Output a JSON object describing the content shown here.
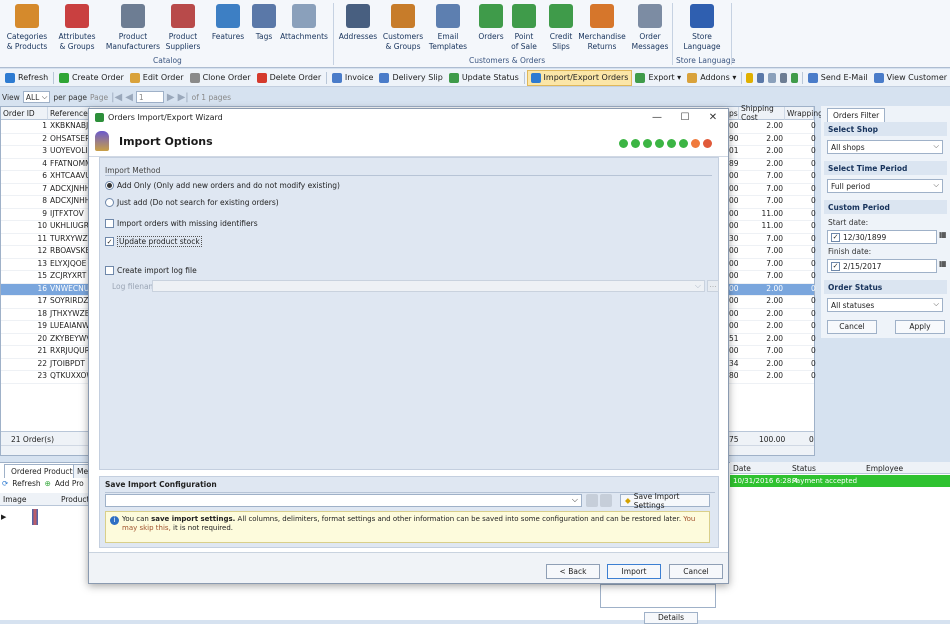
{
  "ribbon": {
    "items": [
      {
        "label": "Categories\n& Products",
        "icon": "categories-products-icon"
      },
      {
        "label": "Attributes\n& Groups",
        "icon": "attributes-icon"
      },
      {
        "label": "Product\nManufacturers",
        "icon": "manufacturer-icon"
      },
      {
        "label": "Product\nSuppliers",
        "icon": "supplier-icon"
      },
      {
        "label": "Features",
        "icon": "features-icon"
      },
      {
        "label": "Tags",
        "icon": "tags-icon"
      },
      {
        "label": "Attachments",
        "icon": "attachments-icon"
      },
      {
        "label": "Addresses",
        "icon": "addresses-icon"
      },
      {
        "label": "Customers\n& Groups",
        "icon": "customers-icon"
      },
      {
        "label": "Email\nTemplates",
        "icon": "email-templates-icon"
      },
      {
        "label": "Orders",
        "icon": "orders-icon"
      },
      {
        "label": "Point\nof Sale",
        "icon": "point-of-sale-icon"
      },
      {
        "label": "Credit\nSlips",
        "icon": "credit-slips-icon"
      },
      {
        "label": "Merchandise\nReturns",
        "icon": "returns-icon"
      },
      {
        "label": "Order\nMessages",
        "icon": "order-messages-icon"
      },
      {
        "label": "Store\nLanguage",
        "icon": "store-language-icon"
      }
    ],
    "groups": [
      "Catalog",
      "Customers & Orders",
      "Store Language"
    ]
  },
  "toolbar": {
    "items": [
      "Refresh",
      "Create Order",
      "Edit Order",
      "Clone Order",
      "Delete Order",
      "Invoice",
      "Delivery Slip",
      "Update Status",
      "Import/Export Orders",
      "Export ▾",
      "Addons ▾",
      "Send E-Mail",
      "View Customer"
    ]
  },
  "pager": {
    "view": "View",
    "all": "ALL",
    "per_page": "per page",
    "page": "Page",
    "page_num": "1",
    "of_pages": "of 1 pages"
  },
  "grid": {
    "headers": [
      "Order ID",
      "Reference",
      "ps",
      "Shipping Cost",
      "Wrapping"
    ],
    "rows": [
      {
        "id": "1",
        "ref": "XKBKNABJK",
        "a": "00",
        "ship": "2.00",
        "w": "0"
      },
      {
        "id": "2",
        "ref": "OHSATSERP",
        "a": "90",
        "ship": "2.00",
        "w": "0"
      },
      {
        "id": "3",
        "ref": "UOYEVOLI",
        "a": "01",
        "ship": "2.00",
        "w": "0"
      },
      {
        "id": "4",
        "ref": "FFATNOMM",
        "a": "89",
        "ship": "2.00",
        "w": "0"
      },
      {
        "id": "6",
        "ref": "XHTCAAVU",
        "a": "00",
        "ship": "7.00",
        "w": "0"
      },
      {
        "id": "7",
        "ref": "ADCXJNHH",
        "a": "00",
        "ship": "7.00",
        "w": "0"
      },
      {
        "id": "8",
        "ref": "ADCXJNHH",
        "a": "00",
        "ship": "7.00",
        "w": "0"
      },
      {
        "id": "9",
        "ref": "IJTFXTOV",
        "a": "00",
        "ship": "11.00",
        "w": "0"
      },
      {
        "id": "10",
        "ref": "UKHLIUGR",
        "a": "00",
        "ship": "11.00",
        "w": "0"
      },
      {
        "id": "11",
        "ref": "TURXYWZV",
        "a": "30",
        "ship": "7.00",
        "w": "0"
      },
      {
        "id": "12",
        "ref": "RBOAVSKB",
        "a": "00",
        "ship": "7.00",
        "w": "0"
      },
      {
        "id": "13",
        "ref": "ELYXJQOE",
        "a": "00",
        "ship": "7.00",
        "w": "0"
      },
      {
        "id": "15",
        "ref": "ZCJRYXRT",
        "a": "00",
        "ship": "7.00",
        "w": "0"
      },
      {
        "id": "16",
        "ref": "VNWECNUM",
        "a": "00",
        "ship": "2.00",
        "w": "0"
      },
      {
        "id": "17",
        "ref": "SOYRIRDZ",
        "a": "00",
        "ship": "2.00",
        "w": "0"
      },
      {
        "id": "18",
        "ref": "JTHXYWZB",
        "a": "00",
        "ship": "2.00",
        "w": "0"
      },
      {
        "id": "19",
        "ref": "LUEAIANW",
        "a": "00",
        "ship": "2.00",
        "w": "0"
      },
      {
        "id": "20",
        "ref": "ZKYBEYWV",
        "a": "51",
        "ship": "2.00",
        "w": "0"
      },
      {
        "id": "21",
        "ref": "RXRJUQUR",
        "a": "00",
        "ship": "7.00",
        "w": "0"
      },
      {
        "id": "22",
        "ref": "JTOIBPDT",
        "a": "34",
        "ship": "2.00",
        "w": "0"
      },
      {
        "id": "23",
        "ref": "QTKUXXOW",
        "a": "80",
        "ship": "2.00",
        "w": "0"
      }
    ],
    "selected_index": 13,
    "footer_count": "21 Order(s)",
    "footer_a": "75",
    "footer_ship": "100.00",
    "footer_w": "0"
  },
  "filter": {
    "tab": "Orders Filter",
    "select_shop": "Select Shop",
    "shop_value": "All shops",
    "select_time": "Select Time Period",
    "time_value": "Full period",
    "custom_period": "Custom Period",
    "start_label": "Start date:",
    "start_value": "12/30/1899",
    "finish_label": "Finish date:",
    "finish_value": "2/15/2017",
    "order_status": "Order Status",
    "status_value": "All statuses",
    "cancel": "Cancel",
    "apply": "Apply"
  },
  "bottom": {
    "tabs": [
      "Ordered Products",
      "Mes"
    ],
    "refresh": "Refresh",
    "add": "Add Pro",
    "col_image": "Image",
    "col_product": "Product",
    "hist_headers": [
      "Date",
      "Status",
      "Employee"
    ],
    "hist_date": "10/31/2016 6:28:4",
    "hist_status": "Payment accepted",
    "details_btn": "Details"
  },
  "dialog": {
    "window_title": "Orders Import/Export Wizard",
    "heading": "Import Options",
    "import_method": "Import Method",
    "opt_add_only": "Add Only (Only add new orders and do not modify existing)",
    "opt_just_add": "Just add (Do not search for existing orders)",
    "chk_missing": "Import orders with missing identifiers",
    "chk_stock": "Update product stock",
    "chk_log": "Create import log file",
    "log_label": "Log filename",
    "save_title": "Save Import Configuration",
    "save_btn": "Save Import Settings",
    "info_a": "You can ",
    "info_b": "save import settings.",
    "info_c": " All columns, delimiters, format settings and other information can be saved into some configuration and can be restored later. ",
    "info_d": "You may skip this,",
    "info_e": " it is not required.",
    "back": "< Back",
    "import": "Import",
    "cancel": "Cancel",
    "steps": [
      "#3cb544",
      "#3cb544",
      "#3cb544",
      "#3cb544",
      "#3cb544",
      "#3cb544",
      "#f07a3c",
      "#e05a3a"
    ]
  }
}
